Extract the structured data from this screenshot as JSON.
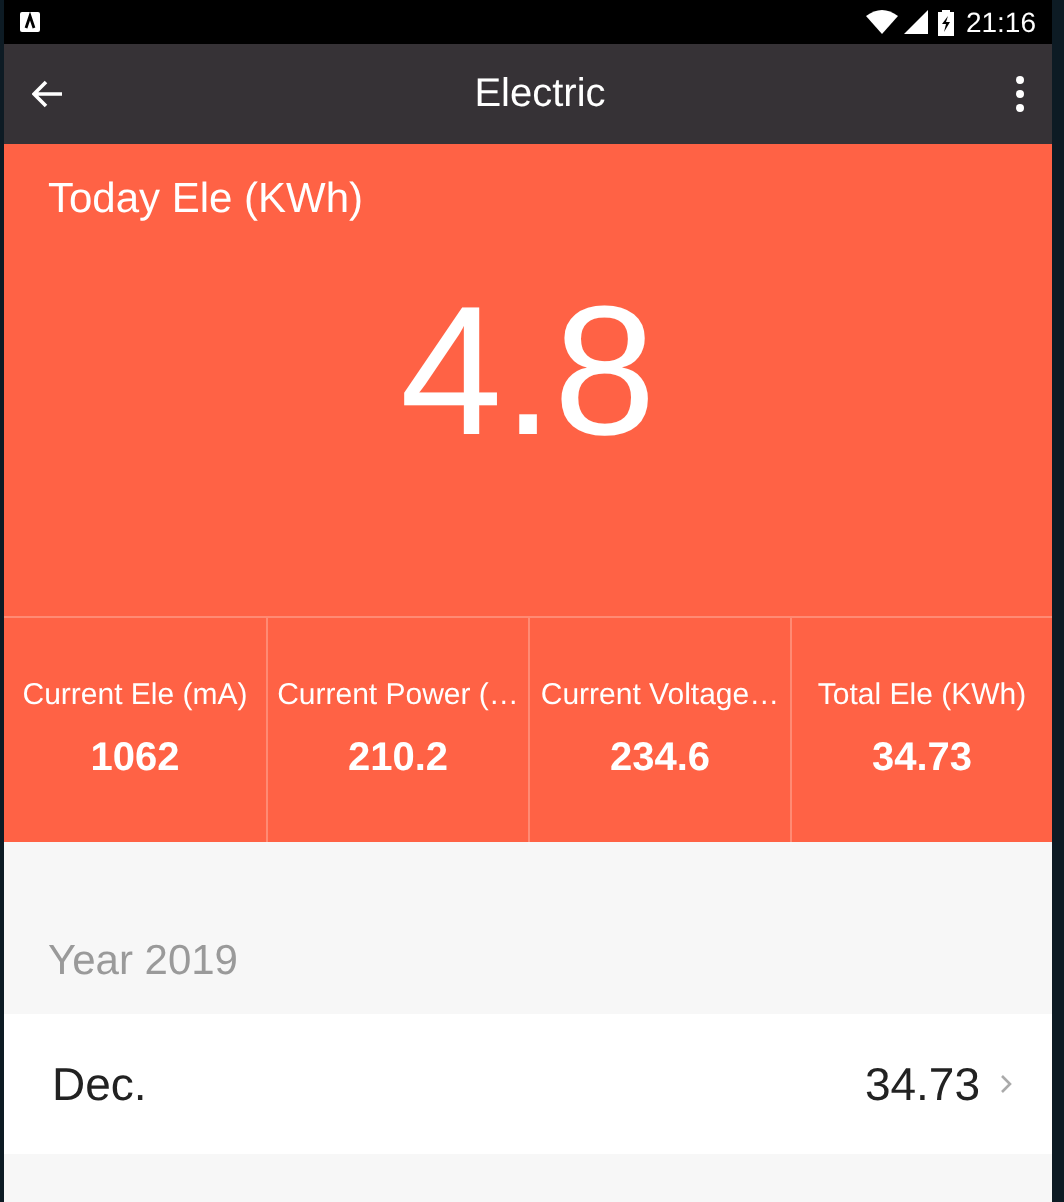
{
  "status_bar": {
    "time": "21:16"
  },
  "app_bar": {
    "title": "Electric"
  },
  "today": {
    "label": "Today Ele (KWh)",
    "value": "4.8"
  },
  "stats": [
    {
      "label": "Current Ele (mA)",
      "value": "1062"
    },
    {
      "label": "Current Power (…",
      "value": "210.2"
    },
    {
      "label": "Current Voltage…",
      "value": "234.6"
    },
    {
      "label": "Total Ele (KWh)",
      "value": "34.73"
    }
  ],
  "year": {
    "label": "Year 2019",
    "months": [
      {
        "name": "Dec.",
        "value": "34.73"
      }
    ]
  }
}
